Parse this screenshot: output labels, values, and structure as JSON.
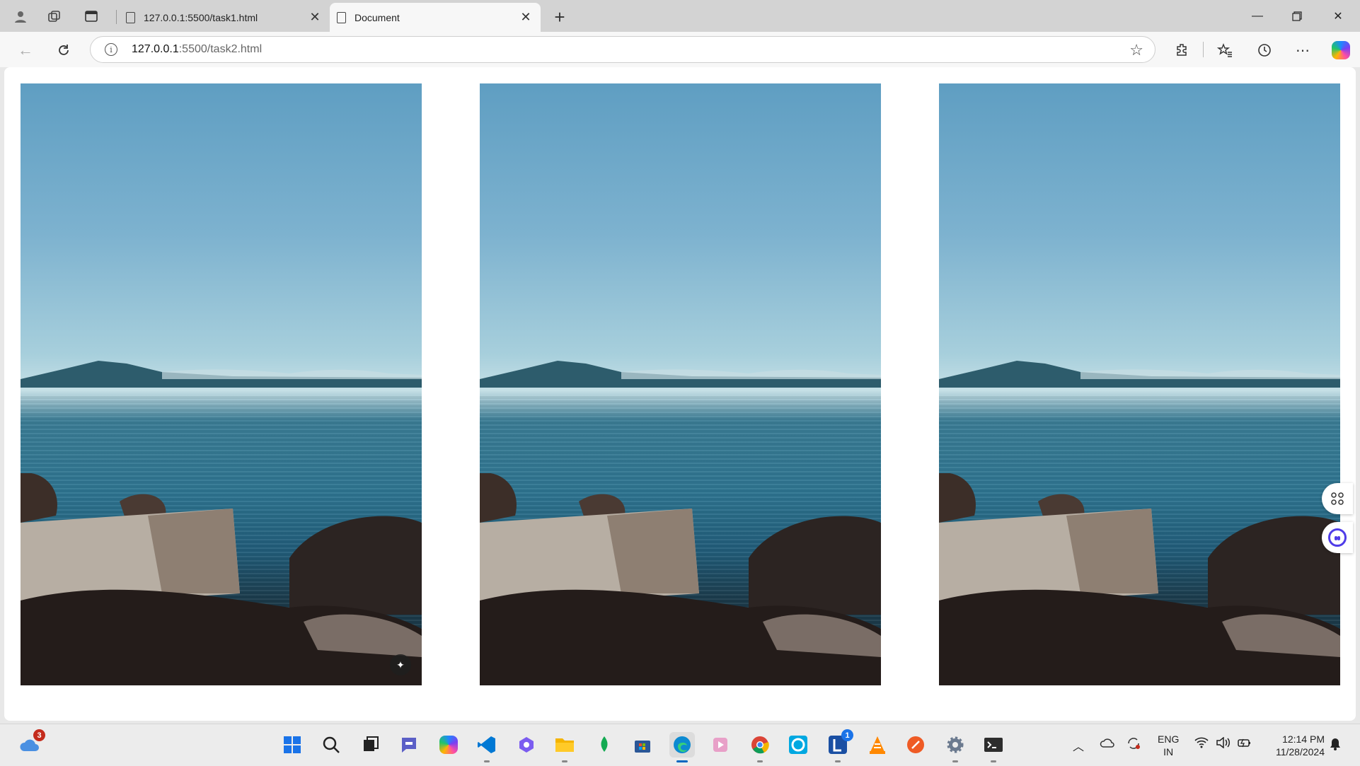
{
  "browser": {
    "tabs": [
      {
        "title": "127.0.0.1:5500/task1.html",
        "active": false
      },
      {
        "title": "Document",
        "active": true
      }
    ],
    "address": {
      "host": "127.0.0.1",
      "rest": ":5500/task2.html"
    }
  },
  "page": {
    "images": [
      {
        "alt_icon": "landscape-photo"
      },
      {
        "alt_icon": "landscape-photo"
      },
      {
        "alt_icon": "landscape-photo"
      }
    ]
  },
  "taskbar": {
    "weather_badge": "3",
    "lens_badge": "1",
    "language": {
      "line1": "ENG",
      "line2": "IN"
    },
    "clock": {
      "time": "12:14 PM",
      "date": "11/28/2024"
    }
  },
  "colors": {
    "accent": "#0067c0",
    "sky": "#7db2cf",
    "sea": "#2e7591"
  }
}
